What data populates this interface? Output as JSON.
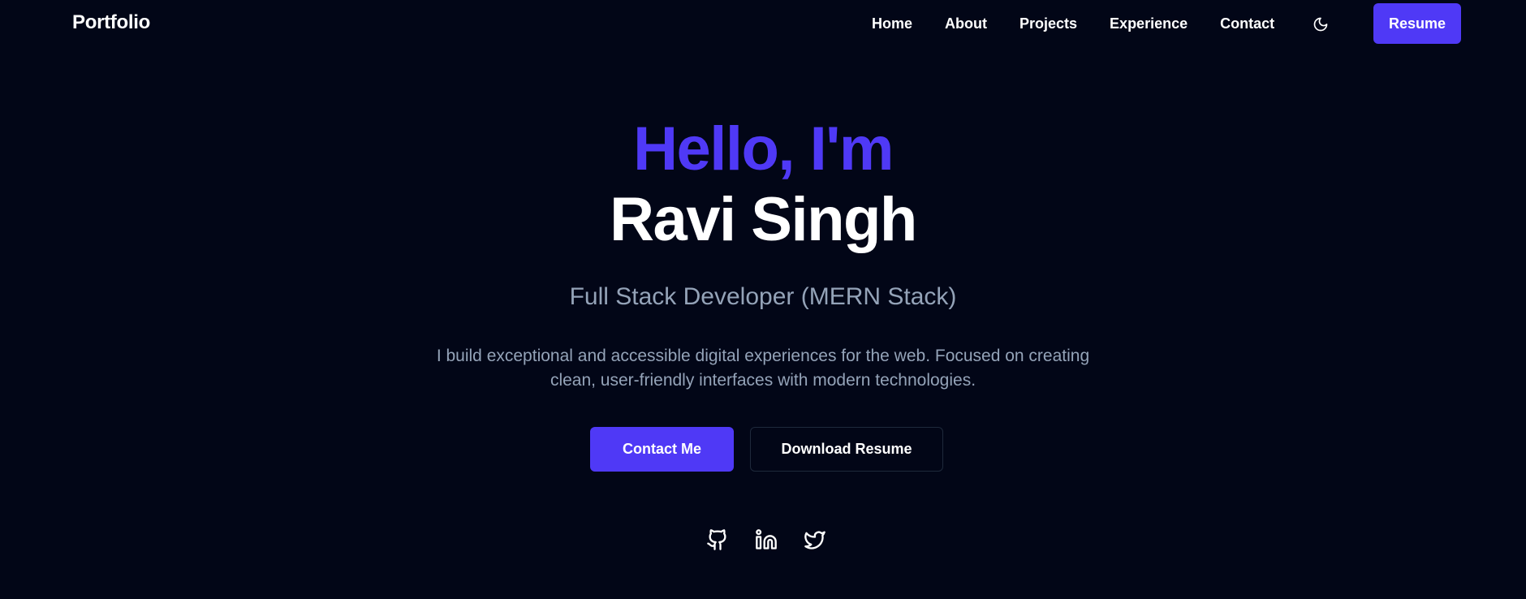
{
  "nav": {
    "logo": "Portfolio",
    "links": [
      {
        "label": "Home"
      },
      {
        "label": "About"
      },
      {
        "label": "Projects"
      },
      {
        "label": "Experience"
      },
      {
        "label": "Contact"
      }
    ],
    "theme_icon": "moon-icon",
    "resume_label": "Resume"
  },
  "hero": {
    "greeting": "Hello, I'm",
    "name": "Ravi Singh",
    "role": "Full Stack Developer (MERN Stack)",
    "description": "I build exceptional and accessible digital experiences for the web. Focused on creating clean, user-friendly interfaces with modern technologies.",
    "primary_cta": "Contact Me",
    "secondary_cta": "Download Resume"
  },
  "socials": [
    {
      "icon": "github-icon"
    },
    {
      "icon": "linkedin-icon"
    },
    {
      "icon": "twitter-icon"
    }
  ],
  "colors": {
    "background": "#020617",
    "accent": "#4f39f6",
    "muted_text": "#94a3b8",
    "text": "#ffffff"
  }
}
